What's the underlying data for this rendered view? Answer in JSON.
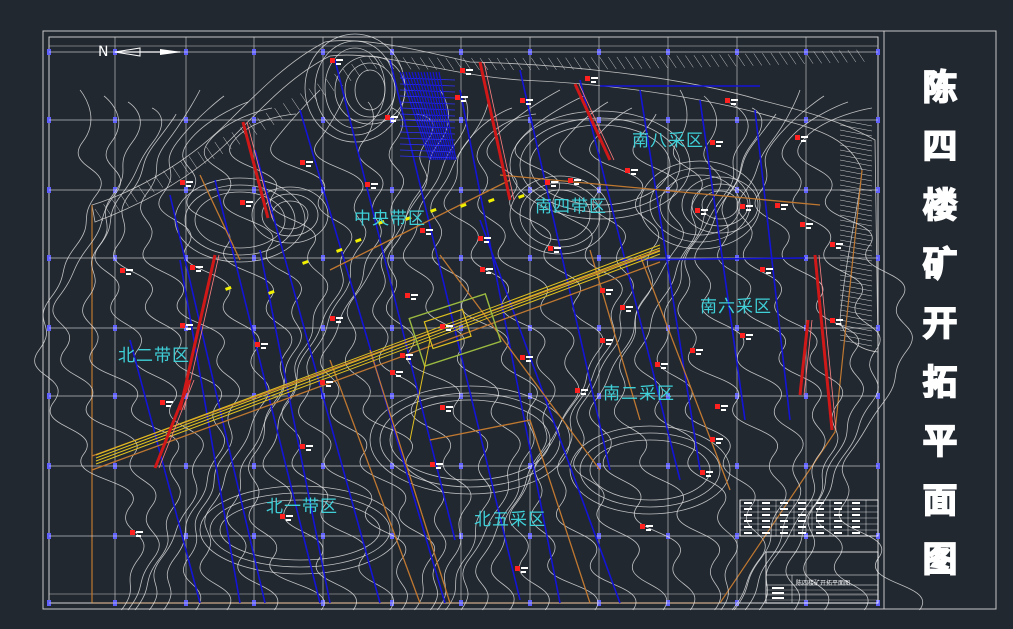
{
  "drawing": {
    "title_chars": [
      "陈",
      "四",
      "楼",
      "矿",
      "开",
      "拓",
      "平",
      "面",
      "图"
    ],
    "north_arrow_label": "N",
    "zones": [
      {
        "id": "zhongyang",
        "label": "中央带区"
      },
      {
        "id": "nansi",
        "label": "南四带区"
      },
      {
        "id": "nanba",
        "label": "南八采区"
      },
      {
        "id": "nanliu",
        "label": "南六采区"
      },
      {
        "id": "nanersi",
        "label": "南二采区"
      },
      {
        "id": "beier",
        "label": "北二带区"
      },
      {
        "id": "beiyi",
        "label": "北一带区"
      },
      {
        "id": "beiwu",
        "label": "北五采区"
      }
    ],
    "title_block_caption": "陈四楼矿开拓平面图"
  },
  "colors": {
    "background": "#212830",
    "frame": "#c8c8c8",
    "grid": "#d8d8d8",
    "contour": "#e6e6e6",
    "fault_blue": "#1414d8",
    "fault_red": "#d01818",
    "roadway_orange": "#c07830",
    "tunnel_yellow": "#e0c020",
    "zone_label": "#3fd0d8",
    "mark_red": "#ff2020",
    "mark_yellow": "#f0f000"
  }
}
